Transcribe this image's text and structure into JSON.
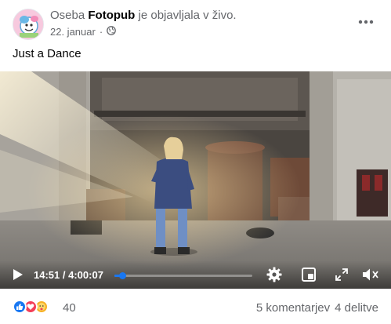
{
  "post": {
    "header_prefix": "Oseba",
    "page_name": "Fotopub",
    "header_suffix": "je objavljala v živo.",
    "date": "22. januar",
    "separator": "·",
    "caption": "Just a Dance"
  },
  "video": {
    "current_time": "14:51",
    "time_separator": "/",
    "duration": "4:00:07",
    "progress_fraction": 0.062,
    "accent_color": "#1877f2"
  },
  "footer": {
    "reaction_icons": [
      "like-icon",
      "love-icon",
      "care-icon"
    ],
    "reaction_count": "40",
    "comments": "5 komentarjev",
    "shares": "4 delitve"
  },
  "icons": {
    "more": "more-options-icon",
    "privacy": "globe-icon",
    "play": "play-icon",
    "settings": "gear-icon",
    "miniplayer": "miniplayer-icon",
    "fullscreen": "fullscreen-icon",
    "volume": "volume-icon"
  }
}
